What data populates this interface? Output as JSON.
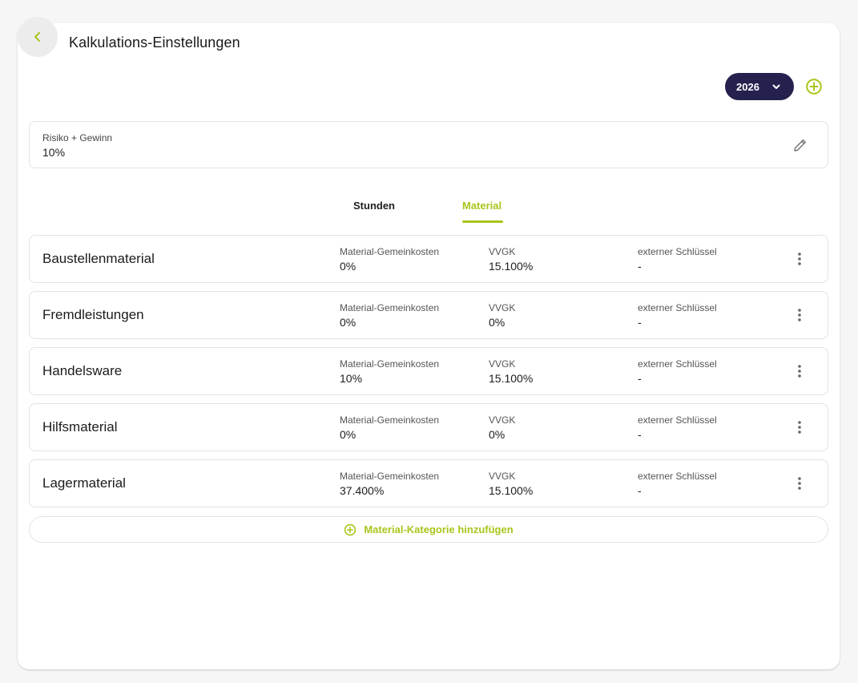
{
  "header": {
    "title": "Kalkulations-Einstellungen"
  },
  "year_select": {
    "value": "2026"
  },
  "risk": {
    "label": "Risiko + Gewinn",
    "value": "10%"
  },
  "tabs": [
    {
      "label": "Stunden",
      "active": false
    },
    {
      "label": "Material",
      "active": true
    }
  ],
  "column_labels": {
    "mgk": "Material-Gemeinkosten",
    "vvgk": "VVGK",
    "ext": "externer Schlüssel"
  },
  "categories": [
    {
      "name": "Baustellenmaterial",
      "mgk": "0%",
      "vvgk": "15.100%",
      "ext": "-"
    },
    {
      "name": "Fremdleistungen",
      "mgk": "0%",
      "vvgk": "0%",
      "ext": "-"
    },
    {
      "name": "Handelsware",
      "mgk": "10%",
      "vvgk": "15.100%",
      "ext": "-"
    },
    {
      "name": "Hilfsmaterial",
      "mgk": "0%",
      "vvgk": "0%",
      "ext": "-"
    },
    {
      "name": "Lagermaterial",
      "mgk": "37.400%",
      "vvgk": "15.100%",
      "ext": "-"
    }
  ],
  "add_category": {
    "label": "Material-Kategorie hinzufügen"
  },
  "colors": {
    "accent": "#a7c61b",
    "dark": "#25214f",
    "background": "#f6f6f6"
  },
  "icons": {
    "back": "chevron-left-icon",
    "year_dropdown": "chevron-down-icon",
    "add_year": "plus-circle-icon",
    "edit": "pencil-icon",
    "row_menu": "more-vertical-icon",
    "add_category": "plus-circle-icon"
  }
}
